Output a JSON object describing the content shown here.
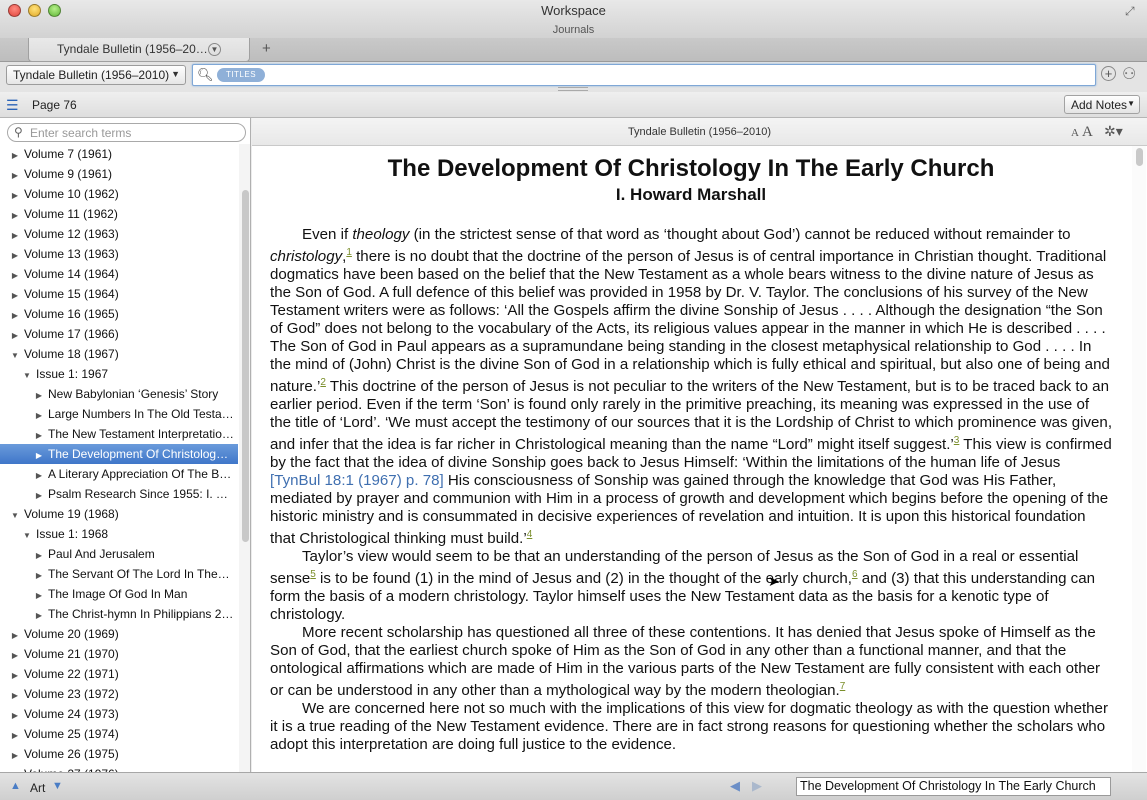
{
  "window": {
    "title": "Workspace",
    "subtitle": "Journals",
    "fullscreen_icon": "expand-arrows-icon"
  },
  "tabs": {
    "active_label": "Tyndale Bulletin (1956–20…",
    "menu_icon": "chevron-down-icon",
    "add_label": "+"
  },
  "toolbar": {
    "resource_select": "Tyndale Bulletin (1956–2010)",
    "search_scope_pill": "TITLES",
    "search_value": "",
    "add_icon": "plus-circle-icon",
    "people_icon": "people-icon"
  },
  "subbar": {
    "page_label": "Page 76",
    "add_notes_label": "Add Notes"
  },
  "sidebar": {
    "search_placeholder": "Enter search terms",
    "rows": [
      {
        "label": "Volume 7 (1961)",
        "level": 0,
        "expanded": false
      },
      {
        "label": "Volume 9 (1961)",
        "level": 0,
        "expanded": false
      },
      {
        "label": "Volume 10 (1962)",
        "level": 0,
        "expanded": false
      },
      {
        "label": "Volume 11 (1962)",
        "level": 0,
        "expanded": false
      },
      {
        "label": "Volume 12 (1963)",
        "level": 0,
        "expanded": false
      },
      {
        "label": "Volume 13 (1963)",
        "level": 0,
        "expanded": false
      },
      {
        "label": "Volume 14 (1964)",
        "level": 0,
        "expanded": false
      },
      {
        "label": "Volume 15 (1964)",
        "level": 0,
        "expanded": false
      },
      {
        "label": "Volume 16 (1965)",
        "level": 0,
        "expanded": false
      },
      {
        "label": "Volume 17 (1966)",
        "level": 0,
        "expanded": false
      },
      {
        "label": "Volume 18 (1967)",
        "level": 0,
        "expanded": true
      },
      {
        "label": "Issue 1: 1967",
        "level": 1,
        "expanded": true
      },
      {
        "label": "New Babylonian ‘Genesis’ Story",
        "level": 2,
        "expanded": false
      },
      {
        "label": "Large Numbers In The Old Testa…",
        "level": 2,
        "expanded": false
      },
      {
        "label": "The New Testament Interpretatio…",
        "level": 2,
        "expanded": false
      },
      {
        "label": "The Development Of Christology…",
        "level": 2,
        "expanded": false,
        "selected": true
      },
      {
        "label": "A Literary Appreciation Of The B…",
        "level": 2,
        "expanded": false
      },
      {
        "label": "Psalm Research Since 1955: I. T…",
        "level": 2,
        "expanded": false
      },
      {
        "label": "Volume 19 (1968)",
        "level": 0,
        "expanded": true
      },
      {
        "label": "Issue 1: 1968",
        "level": 1,
        "expanded": true
      },
      {
        "label": "Paul And Jerusalem",
        "level": 2,
        "expanded": false
      },
      {
        "label": "The Servant Of The Lord In The…",
        "level": 2,
        "expanded": false
      },
      {
        "label": "The Image Of God In Man",
        "level": 2,
        "expanded": false
      },
      {
        "label": "The Christ-hymn In Philippians 2…",
        "level": 2,
        "expanded": false
      },
      {
        "label": "Volume 20 (1969)",
        "level": 0,
        "expanded": false
      },
      {
        "label": "Volume 21 (1970)",
        "level": 0,
        "expanded": false
      },
      {
        "label": "Volume 22 (1971)",
        "level": 0,
        "expanded": false
      },
      {
        "label": "Volume 23 (1972)",
        "level": 0,
        "expanded": false
      },
      {
        "label": "Volume 24 (1973)",
        "level": 0,
        "expanded": false
      },
      {
        "label": "Volume 25 (1974)",
        "level": 0,
        "expanded": false
      },
      {
        "label": "Volume 26 (1975)",
        "level": 0,
        "expanded": false
      },
      {
        "label": "Volume 27 (1976)",
        "level": 0,
        "expanded": false
      }
    ]
  },
  "content": {
    "resource_title": "Tyndale Bulletin (1956–2010)",
    "font_small": "A",
    "font_large": "A",
    "gear_icon": "gear-icon",
    "article_title": "The Development Of Christology In The Early Church",
    "author": "I. Howard Marshall",
    "paragraphs": [
      [
        {
          "t": "Even if "
        },
        {
          "t": "theology",
          "i": true
        },
        {
          "t": " (in the strictest sense of that word as ‘thought about God’) cannot be reduced without remainder to "
        },
        {
          "t": "christology",
          "i": true
        },
        {
          "t": ","
        },
        {
          "t": "1",
          "sup": true
        },
        {
          "t": " there is no doubt that the doctrine of the person of Jesus is of central importance in Christian thought. Traditional dogmatics have been based on the belief that the New Testament as a whole bears witness to the divine nature of Jesus as the Son of God. A full defence of this belief was provided in 1958 by Dr. V. Taylor. The conclusions of his survey of the New Testament writers were as follows: ‘All the Gospels affirm the divine Sonship of Jesus . . . . Although the designation “the Son of God” does not belong to the vocabulary of the Acts, its religious values appear in the manner in which He is described . . . . The Son of God in Paul appears as a supramundane being standing in the closest metaphysical relationship to God . . . . In the mind of (John) Christ is the divine Son of God in a relationship which is fully ethical and spiritual, but also one of being and nature.’"
        },
        {
          "t": "2",
          "sup": true
        },
        {
          "t": " This doctrine of the person of Jesus is not peculiar to the writers of the New Testament, but is to be traced back to an earlier period. Even if the term ‘Son’ is found only rarely in the primitive preaching, its meaning was expressed in the use of the title of ‘Lord’. ‘We must accept the testimony of our sources that it is the Lordship of Christ to which prominence was given, and infer that the idea is far richer in Christological meaning than the name “Lord” might itself suggest.’"
        },
        {
          "t": "3",
          "sup": true
        },
        {
          "t": " This view is confirmed by the fact that the idea of divine Sonship goes back to Jesus Himself: ‘Within the limitations of the human life of Jesus "
        },
        {
          "t": "[TynBul 18:1 (1967) p. 78]",
          "link": true
        },
        {
          "t": " His consciousness of Sonship was gained through the knowledge that God was His Father, mediated by prayer and communion with Him in a process of growth and development which begins before the opening of the historic ministry and is consummated in decisive experiences of revelation and intuition. It is upon this historical foundation that Christological thinking must build.’"
        },
        {
          "t": "4",
          "sup": true
        }
      ],
      [
        {
          "t": "Taylor’s view would seem to be that an understanding of the person of Jesus as the Son of God in a real or essential sense"
        },
        {
          "t": "5",
          "sup": true
        },
        {
          "t": " is to be found (1) in the mind of Jesus and (2) in the thought of the early church,"
        },
        {
          "t": "6",
          "sup": true
        },
        {
          "t": " and (3) that this understanding can form the basis of a modern christology. Taylor himself uses the New Testament data as the basis for a kenotic type of christology."
        }
      ],
      [
        {
          "t": "More recent scholarship has questioned all three of these contentions. It has denied that Jesus spoke of Himself as the Son of God, that the earliest church spoke of Him as the Son of God in any other than a functional manner, and that the ontological affirmations which are made of Him in the various parts of the New Testament are fully consistent with each other or can be understood in any other than a mythological way by the modern theologian."
        },
        {
          "t": "7",
          "sup": true
        }
      ],
      [
        {
          "t": "We are concerned here not so much with the implications of this view for dogmatic theology as with the question whether it is a true reading of the New Testament evidence. There are in fact strong reasons for questioning whether the scholars who adopt this interpretation are doing full justice to the evidence."
        }
      ]
    ]
  },
  "bottombar": {
    "label": "Art",
    "current_title": "The Development Of Christology In The Early Church"
  },
  "colors": {
    "selection": "#3f76c9",
    "link": "#3f6fb0",
    "footnote": "#7a8e2a",
    "accent_pill": "#8fb0d8"
  }
}
